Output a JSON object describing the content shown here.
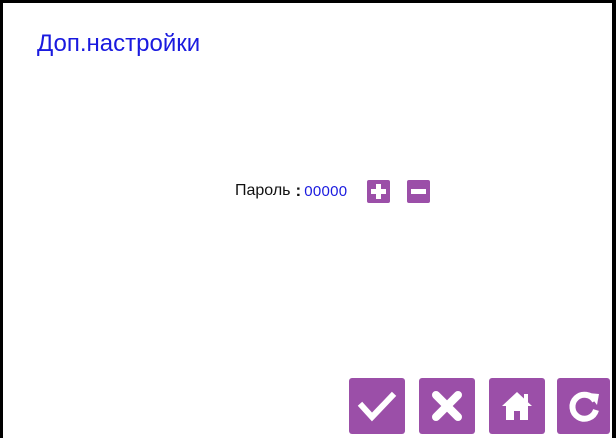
{
  "screen": {
    "title": "Доп.настройки"
  },
  "password": {
    "label": "Пароль",
    "separator": ":",
    "value": "00000"
  },
  "controls": {
    "increment_icon": "plus-icon",
    "decrement_icon": "minus-icon"
  },
  "toolbar": {
    "confirm_icon": "checkmark-icon",
    "cancel_icon": "close-icon",
    "home_icon": "home-icon",
    "refresh_icon": "refresh-icon"
  },
  "colors": {
    "accent": "#9b4fa8",
    "title_text": "#1a1adf",
    "value_text": "#1a1adf",
    "border": "#000000"
  }
}
